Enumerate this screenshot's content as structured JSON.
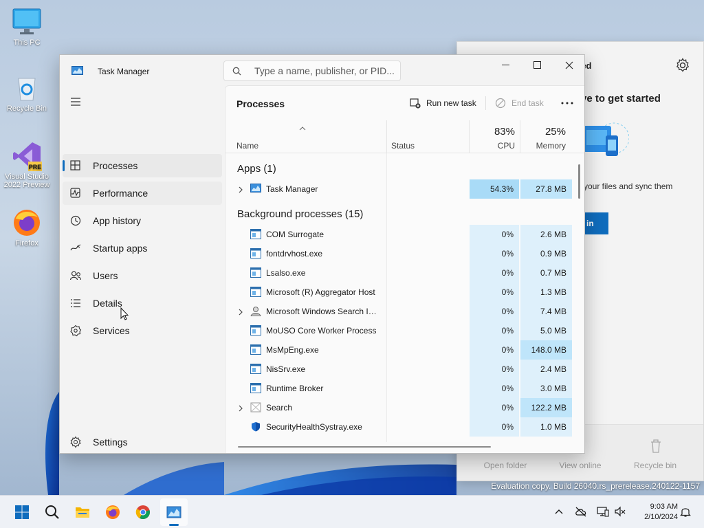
{
  "desktop": {
    "icons": [
      {
        "label": "This PC"
      },
      {
        "label": "Recycle Bin"
      },
      {
        "label": "Visual Studio 2022 Preview",
        "badge": "PRE"
      },
      {
        "label": "Firefox"
      }
    ],
    "eval_text": "Evaluation copy. Build 26040.rs_prerelease.240122-1157"
  },
  "onedrive": {
    "title_partial": "ted",
    "heading_partial": "ve to get started",
    "sub_partial": "your files and sync them",
    "button_partial": "in",
    "footer": [
      "Open folder",
      "View online",
      "Recycle bin"
    ]
  },
  "task_manager": {
    "title": "Task Manager",
    "search_placeholder": "Type a name, publisher, or PID...",
    "nav": [
      {
        "label": "Processes",
        "icon": "processes-icon"
      },
      {
        "label": "Performance",
        "icon": "performance-icon"
      },
      {
        "label": "App history",
        "icon": "app-history-icon"
      },
      {
        "label": "Startup apps",
        "icon": "startup-apps-icon"
      },
      {
        "label": "Users",
        "icon": "users-icon"
      },
      {
        "label": "Details",
        "icon": "details-icon"
      },
      {
        "label": "Services",
        "icon": "services-icon"
      }
    ],
    "settings_label": "Settings",
    "page_title": "Processes",
    "run_new_task": "Run new task",
    "end_task": "End task",
    "columns": {
      "name": "Name",
      "status": "Status",
      "cpu_pct": "83%",
      "cpu": "CPU",
      "mem_pct": "25%",
      "memory": "Memory"
    },
    "apps_header": "Apps (1)",
    "apps": [
      {
        "name": "Task Manager",
        "cpu": "54.3%",
        "memory": "27.8 MB",
        "expandable": true
      }
    ],
    "bg_header": "Background processes (15)",
    "background": [
      {
        "name": "COM Surrogate",
        "cpu": "0%",
        "memory": "2.6 MB",
        "expandable": false
      },
      {
        "name": "fontdrvhost.exe",
        "cpu": "0%",
        "memory": "0.9 MB",
        "expandable": false
      },
      {
        "name": "Lsalso.exe",
        "cpu": "0%",
        "memory": "0.7 MB",
        "expandable": false
      },
      {
        "name": "Microsoft (R) Aggregator Host",
        "cpu": "0%",
        "memory": "1.3 MB",
        "expandable": false
      },
      {
        "name": "Microsoft Windows Search In...",
        "cpu": "0%",
        "memory": "7.4 MB",
        "expandable": true
      },
      {
        "name": "MoUSO Core Worker Process",
        "cpu": "0%",
        "memory": "5.0 MB",
        "expandable": false
      },
      {
        "name": "MsMpEng.exe",
        "cpu": "0%",
        "memory": "148.0 MB",
        "expandable": false
      },
      {
        "name": "NisSrv.exe",
        "cpu": "0%",
        "memory": "2.4 MB",
        "expandable": false
      },
      {
        "name": "Runtime Broker",
        "cpu": "0%",
        "memory": "3.0 MB",
        "expandable": false
      },
      {
        "name": "Search",
        "cpu": "0%",
        "memory": "122.2 MB",
        "expandable": true
      },
      {
        "name": "SecurityHealthSystray.exe",
        "cpu": "0%",
        "memory": "1.0 MB",
        "expandable": false
      }
    ]
  },
  "taskbar": {
    "time": "9:03 AM",
    "date": "2/10/2024"
  },
  "colors": {
    "accent": "#0f6cbd",
    "cpu_hot": "#a9dbf7",
    "cell_light": "#def0fb"
  }
}
